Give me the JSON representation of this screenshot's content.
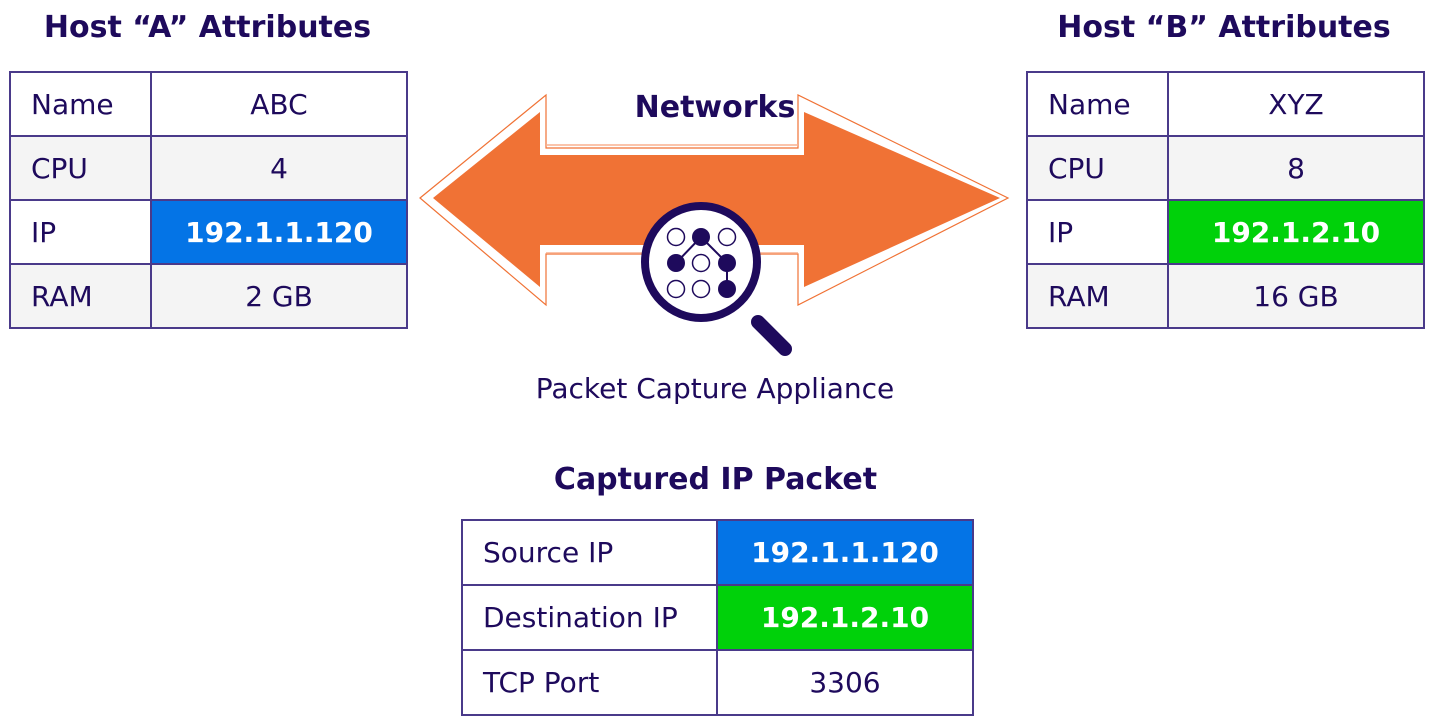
{
  "host_a": {
    "title": "Host “A” Attributes",
    "rows": [
      {
        "key": "Name",
        "value": "ABC"
      },
      {
        "key": "CPU",
        "value": "4"
      },
      {
        "key": "IP",
        "value": "192.1.1.120",
        "highlight": "#0474e6"
      },
      {
        "key": "RAM",
        "value": "2 GB"
      }
    ]
  },
  "host_b": {
    "title": "Host “B” Attributes",
    "rows": [
      {
        "key": "Name",
        "value": "XYZ"
      },
      {
        "key": "CPU",
        "value": "8"
      },
      {
        "key": "IP",
        "value": "192.1.2.10",
        "highlight": "#00d10a"
      },
      {
        "key": "RAM",
        "value": "16 GB"
      }
    ]
  },
  "network": {
    "label": "Networks",
    "arrow_color": "#f07235",
    "icon": "magnifier-network-icon",
    "appliance_label": "Packet Capture Appliance"
  },
  "packet": {
    "title": "Captured IP Packet",
    "rows": [
      {
        "key": "Source IP",
        "value": "192.1.1.120",
        "highlight": "#0474e6"
      },
      {
        "key": "Destination IP",
        "value": "192.1.2.10",
        "highlight": "#00d10a"
      },
      {
        "key": "TCP Port",
        "value": "3306"
      }
    ]
  }
}
